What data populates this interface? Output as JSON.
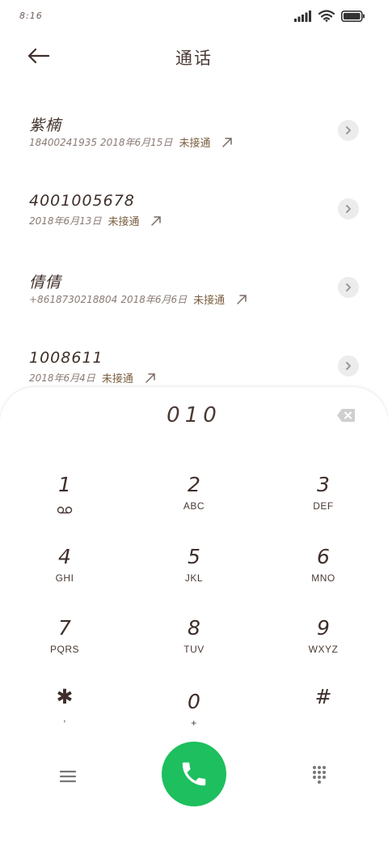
{
  "status_bar": {
    "time": "8:16"
  },
  "header": {
    "title": "通话"
  },
  "call_log": [
    {
      "name": "紫楠",
      "number": "18400241935",
      "date": "2018年6月15日",
      "status": "未接通"
    },
    {
      "name": "4001005678",
      "number": "",
      "date": "2018年6月13日",
      "status": "未接通"
    },
    {
      "name": "倩倩",
      "number": "+8618730218804",
      "date": "2018年6月6日",
      "status": "未接通"
    },
    {
      "name": "1008611",
      "number": "",
      "date": "2018年6月4日",
      "status": "未接通"
    }
  ],
  "dialer": {
    "number": "010",
    "keys": [
      {
        "digit": "1",
        "letters": ""
      },
      {
        "digit": "2",
        "letters": "ABC"
      },
      {
        "digit": "3",
        "letters": "DEF"
      },
      {
        "digit": "4",
        "letters": "GHI"
      },
      {
        "digit": "5",
        "letters": "JKL"
      },
      {
        "digit": "6",
        "letters": "MNO"
      },
      {
        "digit": "7",
        "letters": "PQRS"
      },
      {
        "digit": "8",
        "letters": "TUV"
      },
      {
        "digit": "9",
        "letters": "WXYZ"
      },
      {
        "digit": "✱",
        "letters": ","
      },
      {
        "digit": "0",
        "letters": "+"
      },
      {
        "digit": "#",
        "letters": ""
      }
    ]
  },
  "colors": {
    "call_button": "#1dbf5e",
    "text": "#4a3a34",
    "status": "#7a5e3f"
  },
  "icons": {
    "signal": "signal-icon",
    "wifi": "wifi-icon",
    "battery": "battery-icon",
    "back": "back-arrow-icon",
    "outgoing": "outgoing-call-icon",
    "detail": "chevron-right-icon",
    "backspace": "backspace-icon",
    "voicemail": "voicemail-icon",
    "menu": "menu-icon",
    "call": "phone-icon",
    "keypad": "dialpad-icon"
  }
}
